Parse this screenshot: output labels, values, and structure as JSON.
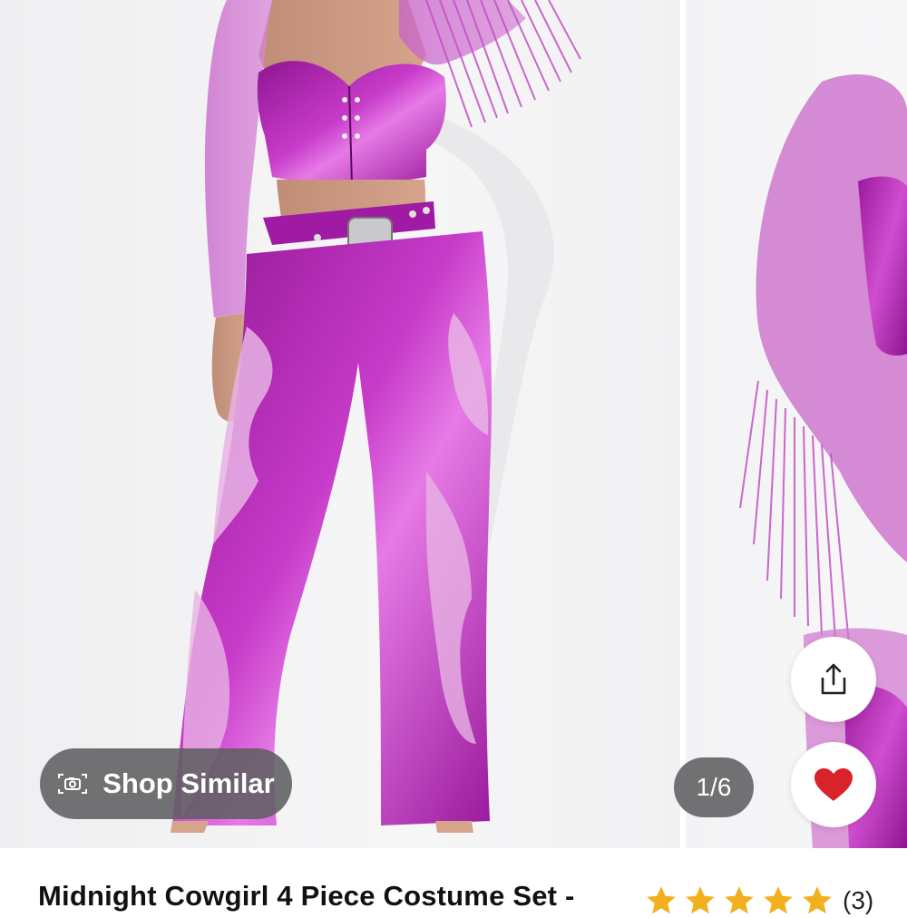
{
  "gallery": {
    "shop_similar_label": "Shop Similar",
    "image_counter": "1/6",
    "share_icon": "share-icon",
    "favorite_icon": "heart-icon",
    "camera_icon": "camera-scan-icon"
  },
  "product": {
    "title": "Midnight Cowgirl 4 Piece Costume Set -",
    "rating_stars": 5,
    "rating_count": "(3)"
  },
  "colors": {
    "outfit_purple": "#b21fb4",
    "outfit_shine": "#d85fd8",
    "heart_red": "#d8232a",
    "star_gold": "#f2b01e",
    "pill_bg": "#5f5f62"
  }
}
